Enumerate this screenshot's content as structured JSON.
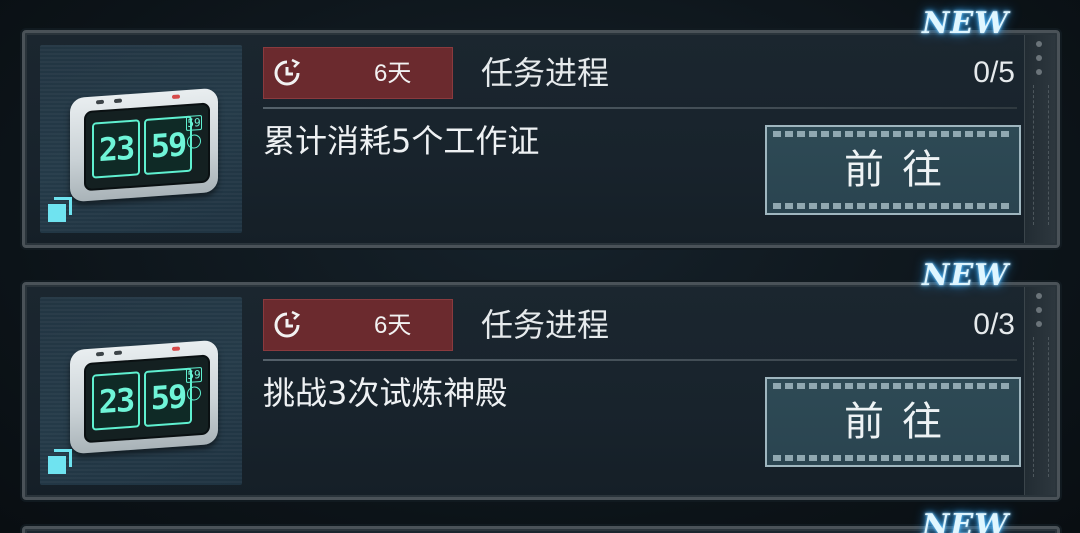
{
  "tasks": [
    {
      "badge": "NEW",
      "remaining": "6天",
      "title": "任务进程",
      "progress": "0/5",
      "description": "累计消耗5个工作证",
      "button": "前往",
      "item": {
        "icon": "alarm-clock-icon",
        "display_hours": "23",
        "display_minutes": "59",
        "display_seconds": "59"
      }
    },
    {
      "badge": "NEW",
      "remaining": "6天",
      "title": "任务进程",
      "progress": "0/3",
      "description": "挑战3次试炼神殿",
      "button": "前往",
      "item": {
        "icon": "alarm-clock-icon",
        "display_hours": "23",
        "display_minutes": "59",
        "display_seconds": "59"
      }
    },
    {
      "badge": "NEW"
    }
  ],
  "colors": {
    "timer_badge": "#6b2a2e",
    "new_glow": "#3fb6ff",
    "clock_digits": "#6ff5d8",
    "button_fill": "#2e4a55"
  }
}
